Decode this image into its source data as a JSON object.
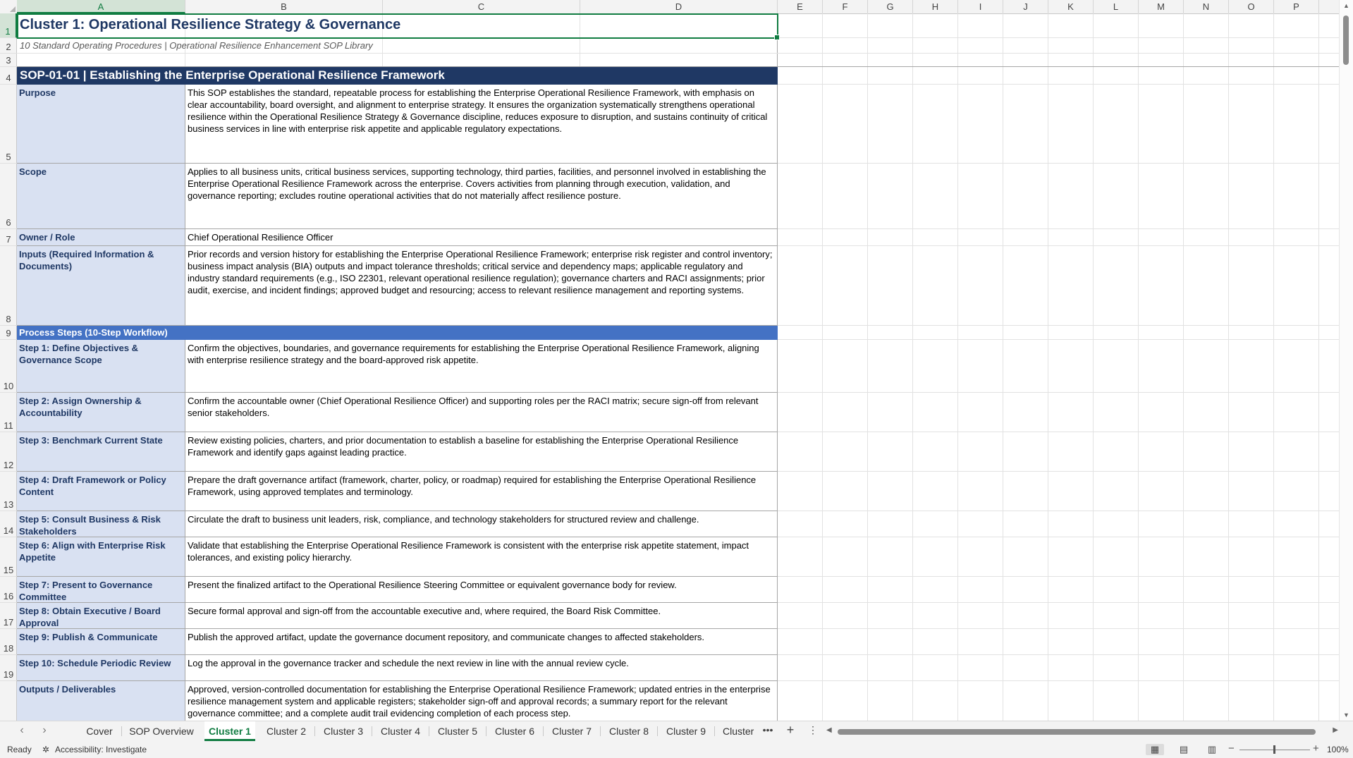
{
  "columns": [
    "A",
    "B",
    "C",
    "D",
    "E",
    "F",
    "G",
    "H",
    "I",
    "J",
    "K",
    "L",
    "M",
    "N",
    "O",
    "P"
  ],
  "rows": [
    "1",
    "2",
    "3",
    "4",
    "5",
    "6",
    "7",
    "8",
    "9",
    "10",
    "11",
    "12",
    "13",
    "14",
    "15",
    "16",
    "17",
    "18",
    "19"
  ],
  "sheet": {
    "title": "Cluster 1: Operational Resilience Strategy & Governance",
    "subtitle": "10 Standard Operating Procedures | Operational Resilience Enhancement SOP Library",
    "sop_header": "SOP-01-01  |  Establishing the Enterprise Operational Resilience Framework",
    "fields": [
      {
        "label": "Purpose",
        "value": "This SOP establishes the standard, repeatable process for establishing the Enterprise Operational Resilience Framework, with emphasis on clear accountability, board oversight, and alignment to enterprise strategy. It ensures the organization systematically strengthens operational resilience within the Operational Resilience Strategy & Governance discipline, reduces exposure to disruption, and sustains continuity of critical business services in line with enterprise risk appetite and applicable regulatory expectations."
      },
      {
        "label": "Scope",
        "value": "Applies to all business units, critical business services, supporting technology, third parties, facilities, and personnel involved in establishing the Enterprise Operational Resilience Framework across the enterprise. Covers activities from planning through execution, validation, and governance reporting; excludes routine operational activities that do not materially affect resilience posture."
      },
      {
        "label": "Owner / Role",
        "value": "Chief Operational Resilience Officer"
      },
      {
        "label": "Inputs (Required Information & Documents)",
        "value": "Prior records and version history for establishing the Enterprise Operational Resilience Framework; enterprise risk register and control inventory; business impact analysis (BIA) outputs and impact tolerance thresholds; critical service and dependency maps; applicable regulatory and industry standard requirements (e.g., ISO 22301, relevant operational resilience regulation); governance charters and RACI assignments; prior audit, exercise, and incident findings; approved budget and resourcing; access to relevant resilience management and reporting systems."
      }
    ],
    "steps_header": "Process Steps (10-Step Workflow)",
    "steps": [
      {
        "label": "Step 1: Define Objectives & Governance Scope",
        "value": "Confirm the objectives, boundaries, and governance requirements for establishing the Enterprise Operational Resilience Framework, aligning with enterprise resilience strategy and the board-approved risk appetite."
      },
      {
        "label": "Step 2: Assign Ownership & Accountability",
        "value": "Confirm the accountable owner (Chief Operational Resilience Officer) and supporting roles per the RACI matrix; secure sign-off from relevant senior stakeholders."
      },
      {
        "label": "Step 3: Benchmark Current State",
        "value": "Review existing policies, charters, and prior documentation to establish a baseline for establishing the Enterprise Operational Resilience Framework and identify gaps against leading practice."
      },
      {
        "label": "Step 4: Draft Framework or Policy Content",
        "value": "Prepare the draft governance artifact (framework, charter, policy, or roadmap) required for establishing the Enterprise Operational Resilience Framework, using approved templates and terminology."
      },
      {
        "label": "Step 5: Consult Business & Risk Stakeholders",
        "value": "Circulate the draft to business unit leaders, risk, compliance, and technology stakeholders for structured review and challenge."
      },
      {
        "label": "Step 6: Align with Enterprise Risk Appetite",
        "value": "Validate that establishing the Enterprise Operational Resilience Framework is consistent with the enterprise risk appetite statement, impact tolerances, and existing policy hierarchy."
      },
      {
        "label": "Step 7: Present to Governance Committee",
        "value": "Present the finalized artifact to the Operational Resilience Steering Committee or equivalent governance body for review."
      },
      {
        "label": "Step 8: Obtain Executive / Board Approval",
        "value": "Secure formal approval and sign-off from the accountable executive and, where required, the Board Risk Committee."
      },
      {
        "label": "Step 9: Publish & Communicate",
        "value": "Publish the approved artifact, update the governance document repository, and communicate changes to affected stakeholders."
      },
      {
        "label": "Step 10: Schedule Periodic Review",
        "value": "Log the approval in the governance tracker and schedule the next review in line with the annual review cycle."
      }
    ],
    "outputs": {
      "label": "Outputs / Deliverables",
      "value": "Approved, version-controlled documentation for establishing the Enterprise Operational Resilience Framework; updated entries in the enterprise resilience management system and applicable registers; stakeholder sign-off and approval records; a summary report for the relevant governance committee; and a complete audit trail evidencing completion of each process step."
    }
  },
  "tabs": [
    "Cover",
    "SOP Overview",
    "Cluster 1",
    "Cluster 2",
    "Cluster 3",
    "Cluster 4",
    "Cluster 5",
    "Cluster 6",
    "Cluster 7",
    "Cluster 8",
    "Cluster 9",
    "Cluster "
  ],
  "active_tab": "Cluster 1",
  "status": {
    "ready": "Ready",
    "accessibility": "Accessibility: Investigate",
    "zoom": "100%"
  },
  "icons": {
    "tab_prev": "chevron-left-icon",
    "tab_next": "chevron-right-icon",
    "add_sheet": "plus-icon",
    "more": "more-icon",
    "accessibility": "accessibility-icon"
  },
  "colors": {
    "accent": "#107c41",
    "header_navy": "#1f3864",
    "steps_blue": "#4472c4",
    "label_fill": "#d9e1f2"
  }
}
